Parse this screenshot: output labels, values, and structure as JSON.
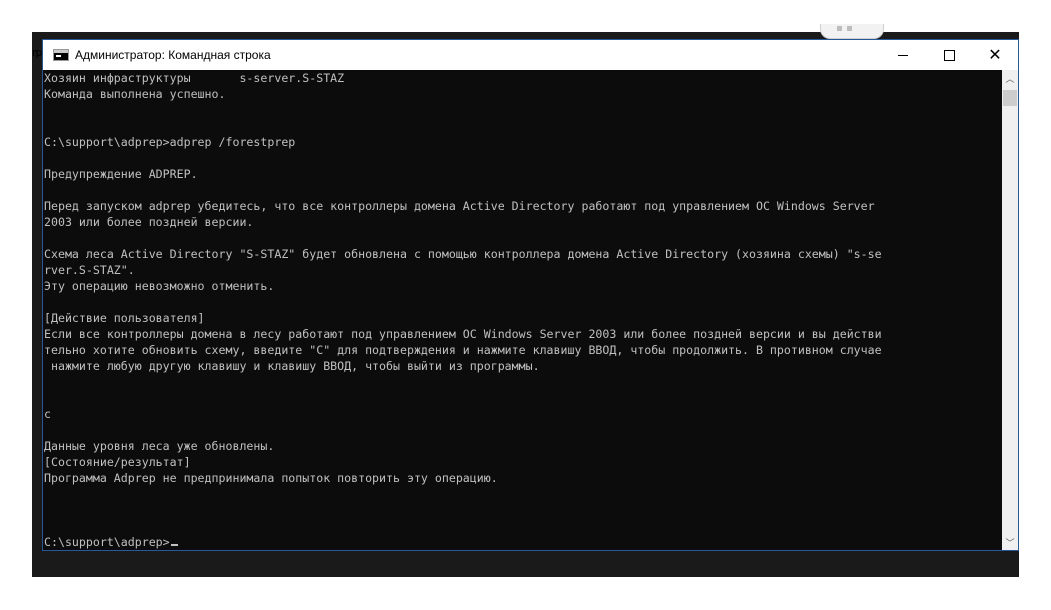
{
  "window": {
    "title": "Администратор: Командная строка",
    "left_fragment": "rp"
  },
  "console": {
    "lines": [
      "Хозяин инфраструктуры       s-server.S-STAZ",
      "Команда выполнена успешно.",
      "",
      "",
      "C:\\support\\adprep>adprep /forestprep",
      "",
      "Предупреждение ADPREP.",
      "",
      "Перед запуском adprep убедитесь, что все контроллеры домена Active Directory работают под управлением ОС Windows Server",
      "2003 или более поздней версии.",
      "",
      "Схема леса Active Directory \"S-STAZ\" будет обновлена с помощью контроллера домена Active Directory (хозяина схемы) \"s-se",
      "rver.S-STAZ\".",
      "Эту операцию невозможно отменить.",
      "",
      "[Действие пользователя]",
      "Если все контроллеры домена в лесу работают под управлением ОС Windows Server 2003 или более поздней версии и вы действи",
      "тельно хотите обновить схему, введите \"C\" для подтверждения и нажмите клавишу ВВОД, чтобы продолжить. В противном случае",
      " нажмите любую другую клавишу и клавишу ВВОД, чтобы выйти из программы.",
      "",
      "",
      "c",
      "",
      "Данные уровня леса уже обновлены.",
      "[Состояние/результат]",
      "Программа Adprep не предпринимала попыток повторить эту операцию.",
      "",
      "",
      "",
      "C:\\support\\adprep>"
    ]
  },
  "colors": {
    "console_bg": "#0c0c0c",
    "console_text": "#c0c0c0",
    "titlebar_bg": "#ffffff",
    "window_border": "#2b5797"
  },
  "icons": {
    "app": "cmd-icon",
    "minimize": "minimize-icon",
    "maximize": "maximize-icon",
    "close": "close-icon",
    "scroll_up": "chevron-up-icon",
    "scroll_down": "chevron-down-icon"
  }
}
